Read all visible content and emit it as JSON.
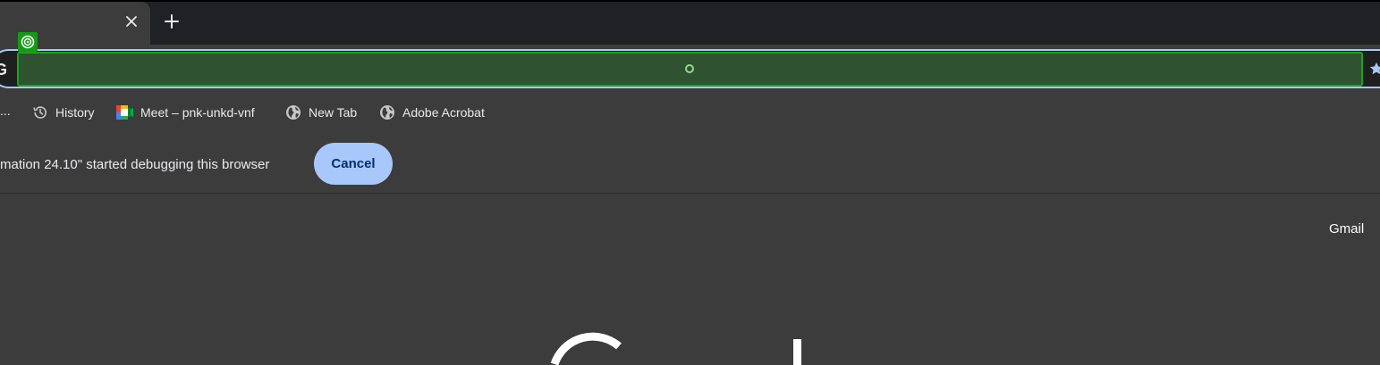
{
  "tabs": [
    {
      "label": "",
      "active": true
    }
  ],
  "tab_strip": {
    "close_icon": "close-icon",
    "new_tab_icon": "plus-icon"
  },
  "omnibox": {
    "value": "",
    "search_engine_icon": "google-g-icon",
    "bookmark_icon": "star-icon"
  },
  "bookmarks_bar": {
    "overflow_label": "...",
    "items": [
      {
        "label": "History",
        "icon": "history-icon"
      },
      {
        "label": "Meet – pnk-unkd-vnf",
        "icon": "google-meet-icon"
      },
      {
        "label": "New Tab",
        "icon": "globe-icon"
      },
      {
        "label": "Adobe Acrobat",
        "icon": "globe-icon"
      }
    ]
  },
  "infobar": {
    "message": "mation 24.10\" started debugging this browser",
    "cancel_label": "Cancel"
  },
  "page": {
    "gmail_label": "Gmail",
    "logo": "google-logo"
  },
  "colors": {
    "background": "#3c3c3c",
    "tabstrip": "#202124",
    "focus_ring": "#a8c7fa",
    "cancel_button": "#a8c7fa",
    "highlight_fill": "#2f5230",
    "highlight_border": "#18a518"
  }
}
